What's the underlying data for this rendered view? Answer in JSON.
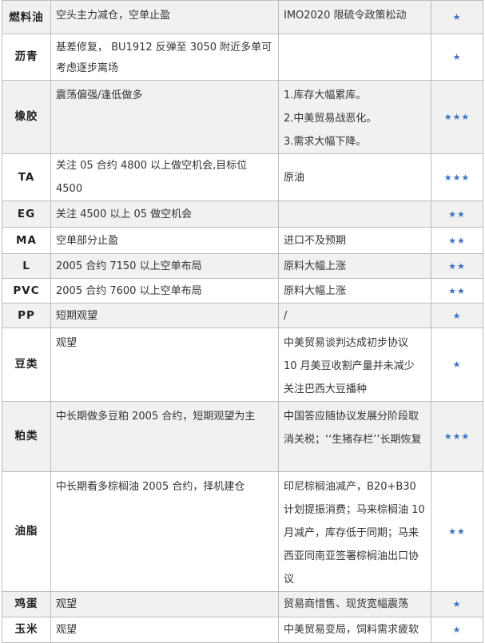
{
  "rows": [
    {
      "name": "燃料油",
      "view": "空头主力减仓，空单止盈",
      "reason": [
        "IMO2020 限硫令政策松动"
      ],
      "stars": "★"
    },
    {
      "name": "沥青",
      "view": "基差修复， BU1912 反弹至 3050 附近多单可考虑逐步离场",
      "reason": [],
      "stars": "★"
    },
    {
      "name": "橡胶",
      "view": "震荡偏强/逢低做多",
      "reason": [
        "1.库存大幅累库。",
        "2.中美贸易战恶化。",
        "3.需求大幅下降。"
      ],
      "stars": "★★★"
    },
    {
      "name": "TA",
      "view": "关注 05 合约 4800 以上做空机会,目标位 4500",
      "reason": [
        "原油"
      ],
      "stars": "★★★"
    },
    {
      "name": "EG",
      "view": "关注 4500 以上 05 做空机会",
      "reason": [],
      "stars": "★★"
    },
    {
      "name": "MA",
      "view": "空单部分止盈",
      "reason": [
        "进口不及预期"
      ],
      "stars": "★★"
    },
    {
      "name": "L",
      "view": "2005 合约 7150 以上空单布局",
      "reason": [
        "原料大幅上涨"
      ],
      "stars": "★★"
    },
    {
      "name": "PVC",
      "view": "2005 合约 7600 以上空单布局",
      "reason": [
        "原料大幅上涨"
      ],
      "stars": "★★"
    },
    {
      "name": "PP",
      "view": "短期观望",
      "reason": [
        "/"
      ],
      "stars": "★"
    },
    {
      "name": "豆类",
      "view": "观望",
      "reason": [
        "中美贸易谈判达成初步协议",
        "10 月美豆收割产量并未减少",
        "关注巴西大豆播种"
      ],
      "stars": "★"
    },
    {
      "name": "粕类",
      "view": "中长期做多豆粕 2005 合约，短期观望为主",
      "reason": [
        "中国答应随协议发展分阶段取消关税；‘‘生猪存栏’’长期恢复"
      ],
      "stars": "★★★"
    },
    {
      "name": "油脂",
      "view": "中长期看多棕榈油 2005 合约，择机建仓",
      "reason": [
        "印尼棕榈油减产，B20+B30 计划提振消费；马来棕榈油 10 月减产，库存低于同期；马来西亚同南亚签署棕榈油出口协议"
      ],
      "stars": "★★"
    },
    {
      "name": "鸡蛋",
      "view": "观望",
      "reason": [
        "贸易商惜售、现货宽幅震荡"
      ],
      "stars": "★"
    },
    {
      "name": "玉米",
      "view": "观望",
      "reason": [
        "中美贸易变局，饲料需求疲软"
      ],
      "stars": "★"
    }
  ]
}
